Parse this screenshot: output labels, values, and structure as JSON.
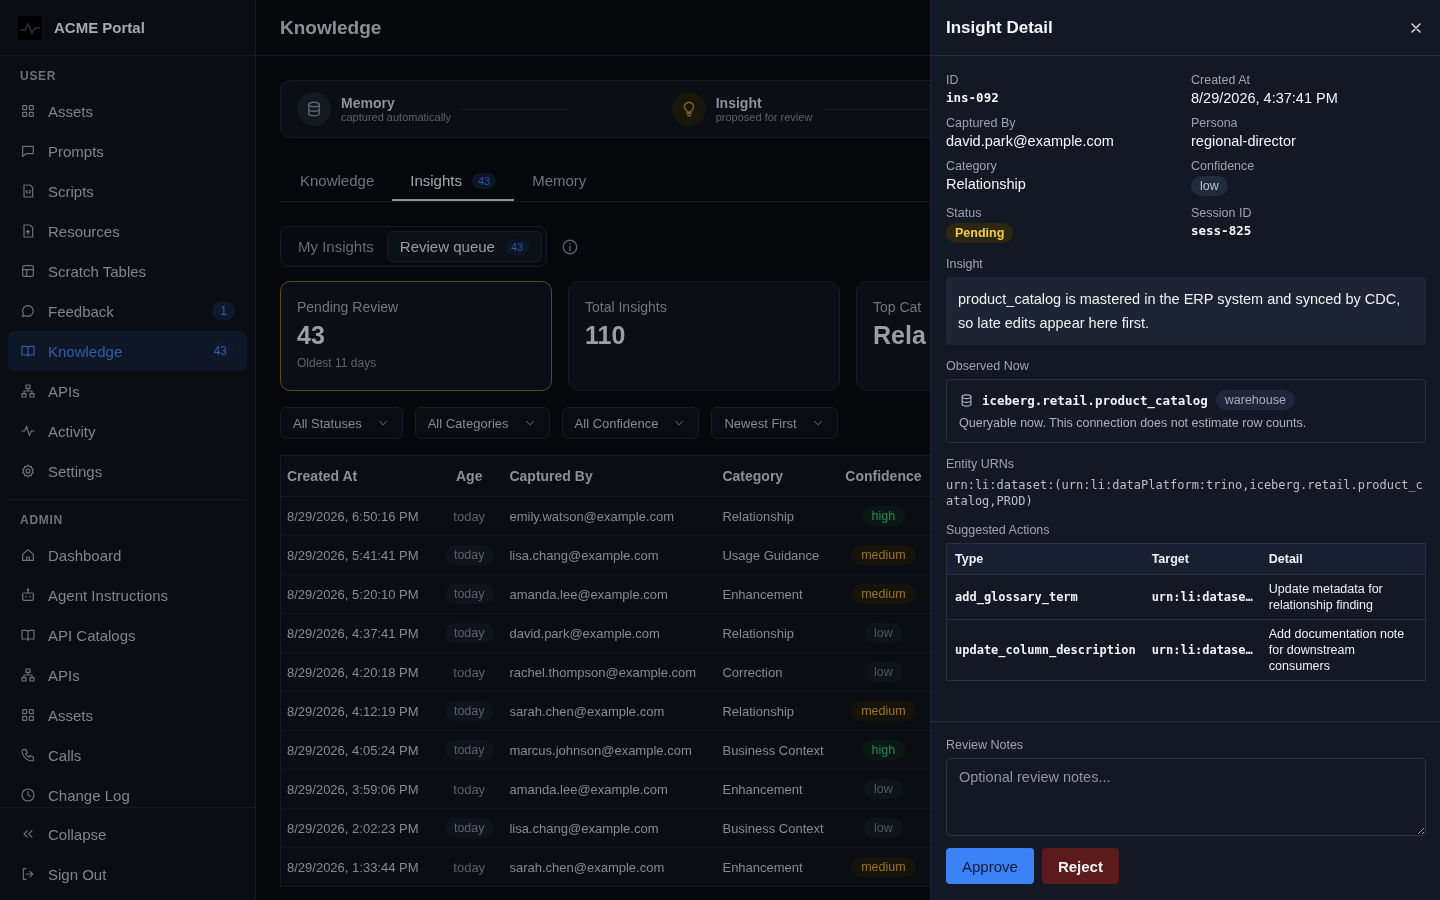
{
  "sidebar": {
    "logo_text": "ACME Portal",
    "sections": [
      {
        "title": "USER",
        "items": [
          {
            "label": "Assets",
            "selected": false
          },
          {
            "label": "Prompts",
            "selected": false
          },
          {
            "label": "Scripts",
            "selected": false
          },
          {
            "label": "Resources",
            "selected": false
          },
          {
            "label": "Scratch Tables",
            "selected": false
          },
          {
            "label": "Feedback",
            "badge": "1",
            "selected": false
          },
          {
            "label": "Knowledge",
            "badge": "43",
            "selected": true
          },
          {
            "label": "APIs",
            "selected": false
          },
          {
            "label": "Activity",
            "selected": false
          },
          {
            "label": "Settings",
            "selected": false
          }
        ]
      },
      {
        "title": "ADMIN",
        "items": [
          {
            "label": "Dashboard",
            "selected": false
          },
          {
            "label": "Agent Instructions",
            "selected": false
          },
          {
            "label": "API Catalogs",
            "selected": false
          },
          {
            "label": "APIs",
            "selected": false
          },
          {
            "label": "Assets",
            "selected": false
          },
          {
            "label": "Calls",
            "selected": false
          },
          {
            "label": "Change Log",
            "selected": false
          }
        ]
      }
    ],
    "footer_items": [
      {
        "label": "Collapse"
      },
      {
        "label": "Sign Out"
      }
    ]
  },
  "main": {
    "title": "Knowledge",
    "flow": [
      {
        "title": "Memory",
        "subtitle": "captured automatically"
      },
      {
        "title": "Insight",
        "subtitle": "proposed for review"
      }
    ],
    "tabs": [
      {
        "label": "Knowledge",
        "selected": false
      },
      {
        "label": "Insights",
        "count": "43",
        "selected": true
      },
      {
        "label": "Memory",
        "selected": false
      }
    ],
    "subtabs": [
      {
        "label": "My Insights",
        "selected": false
      },
      {
        "label": "Review queue",
        "count": "43",
        "selected": true
      }
    ],
    "stats": [
      {
        "label": "Pending Review",
        "value": "43",
        "note": "Oldest 11 days",
        "selected": true
      },
      {
        "label": "Total Insights",
        "value": "110",
        "selected": false
      },
      {
        "label": "Top Cat",
        "value": "Rela",
        "selected": false
      }
    ],
    "filters": [
      "All Statuses",
      "All Categories",
      "All Confidence",
      "Newest First"
    ],
    "table": {
      "columns": [
        "Created At",
        "Age",
        "Captured By",
        "Category",
        "Confidence"
      ],
      "rows": [
        {
          "created_at": "8/29/2026, 6:50:16 PM",
          "age": {
            "text": "today",
            "pill": false
          },
          "captured_by": "emily.watson@example.com",
          "category": "Relationship",
          "confidence": {
            "label": "high",
            "kind": "high"
          }
        },
        {
          "created_at": "8/29/2026, 5:41:41 PM",
          "age": {
            "text": "today",
            "pill": true
          },
          "captured_by": "lisa.chang@example.com",
          "category": "Usage Guidance",
          "confidence": {
            "label": "medium",
            "kind": "medium"
          }
        },
        {
          "created_at": "8/29/2026, 5:20:10 PM",
          "age": {
            "text": "today",
            "pill": true
          },
          "captured_by": "amanda.lee@example.com",
          "category": "Enhancement",
          "confidence": {
            "label": "medium",
            "kind": "medium"
          }
        },
        {
          "created_at": "8/29/2026, 4:37:41 PM",
          "age": {
            "text": "today",
            "pill": true
          },
          "captured_by": "david.park@example.com",
          "category": "Relationship",
          "confidence": {
            "label": "low",
            "kind": "low"
          }
        },
        {
          "created_at": "8/29/2026, 4:20:18 PM",
          "age": {
            "text": "today",
            "pill": false
          },
          "captured_by": "rachel.thompson@example.com",
          "category": "Correction",
          "confidence": {
            "label": "low",
            "kind": "low"
          }
        },
        {
          "created_at": "8/29/2026, 4:12:19 PM",
          "age": {
            "text": "today",
            "pill": true
          },
          "captured_by": "sarah.chen@example.com",
          "category": "Relationship",
          "confidence": {
            "label": "medium",
            "kind": "medium"
          }
        },
        {
          "created_at": "8/29/2026, 4:05:24 PM",
          "age": {
            "text": "today",
            "pill": true
          },
          "captured_by": "marcus.johnson@example.com",
          "category": "Business Context",
          "confidence": {
            "label": "high",
            "kind": "high"
          }
        },
        {
          "created_at": "8/29/2026, 3:59:06 PM",
          "age": {
            "text": "today",
            "pill": false
          },
          "captured_by": "amanda.lee@example.com",
          "category": "Enhancement",
          "confidence": {
            "label": "low",
            "kind": "low"
          }
        },
        {
          "created_at": "8/29/2026, 2:02:23 PM",
          "age": {
            "text": "today",
            "pill": true
          },
          "captured_by": "lisa.chang@example.com",
          "category": "Business Context",
          "confidence": {
            "label": "low",
            "kind": "low"
          }
        },
        {
          "created_at": "8/29/2026, 1:33:44 PM",
          "age": {
            "text": "today",
            "pill": false
          },
          "captured_by": "sarah.chen@example.com",
          "category": "Enhancement",
          "confidence": {
            "label": "medium",
            "kind": "medium"
          }
        }
      ]
    }
  },
  "panel": {
    "title": "Insight Detail",
    "fields": [
      {
        "label": "ID",
        "value": "ins-092",
        "kind": "mono"
      },
      {
        "label": "Created At",
        "value": "8/29/2026, 4:37:41 PM",
        "kind": "text"
      },
      {
        "label": "Captured By",
        "value": "david.park@example.com",
        "kind": "text"
      },
      {
        "label": "Persona",
        "value": "regional-director",
        "kind": "text"
      },
      {
        "label": "Category",
        "value": "Relationship",
        "kind": "text"
      },
      {
        "label": "Confidence",
        "value": "low",
        "kind": "low"
      },
      {
        "label": "Status",
        "value": "Pending",
        "kind": "pending"
      },
      {
        "label": "Session ID",
        "value": "sess-825",
        "kind": "mono"
      }
    ],
    "insight": {
      "label": "Insight",
      "text": "product_catalog is mastered in the ERP system and synced by CDC, so late edits appear here first."
    },
    "observed": {
      "label": "Observed Now",
      "dataset": "iceberg.retail.product_catalog",
      "tag": "warehouse",
      "note": "Queryable now. This connection does not estimate row counts."
    },
    "entity_urns": {
      "label": "Entity URNs",
      "value": "urn:li:dataset:(urn:li:dataPlatform:trino,iceberg.retail.product_catalog,PROD)"
    },
    "suggested_actions": {
      "label": "Suggested Actions",
      "columns": [
        "Type",
        "Target",
        "Detail"
      ],
      "rows": [
        {
          "type": "add_glossary_term",
          "target": "urn:li:datase…",
          "detail": "Update metadata for relationship finding"
        },
        {
          "type": "update_column_description",
          "target": "urn:li:datase…",
          "detail": "Add documentation note for downstream consumers"
        }
      ]
    },
    "review_notes": {
      "label": "Review Notes",
      "placeholder": "Optional review notes..."
    },
    "buttons": [
      {
        "label": "Approve",
        "kind": "approve"
      },
      {
        "label": "Reject",
        "kind": "reject"
      }
    ]
  }
}
